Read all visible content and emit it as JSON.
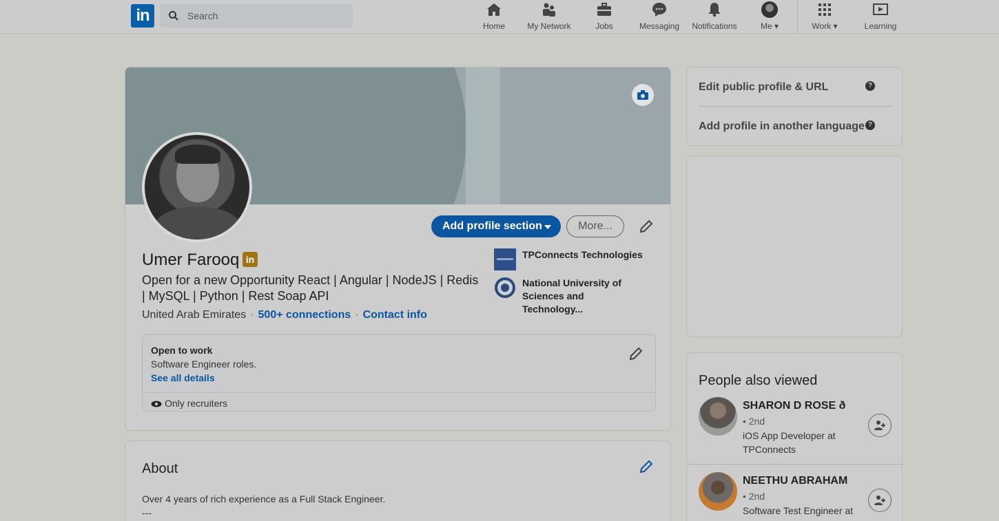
{
  "nav": {
    "logo_text": "in",
    "search_placeholder": "Search",
    "items": [
      {
        "label": "Home",
        "icon": "home-icon"
      },
      {
        "label": "My Network",
        "icon": "network-icon"
      },
      {
        "label": "Jobs",
        "icon": "briefcase-icon"
      },
      {
        "label": "Messaging",
        "icon": "messaging-icon"
      },
      {
        "label": "Notifications",
        "icon": "bell-icon"
      },
      {
        "label": "Me",
        "icon": "avatar"
      },
      {
        "label": "Work",
        "icon": "grid-icon"
      },
      {
        "label": "Learning",
        "icon": "learning-icon"
      }
    ]
  },
  "profile": {
    "name": "Umer Farooq",
    "badge": "in",
    "headline": "Open for a new Opportunity React | Angular | NodeJS | Redis | MySQL | Python | Rest Soap API",
    "location": "United Arab Emirates",
    "connections": "500+ connections",
    "contact": "Contact info",
    "add_section_label": "Add profile section",
    "more_label": "More...",
    "orgs": [
      {
        "name": "TPConnects Technologies"
      },
      {
        "name": "National University of Sciences and Technology..."
      }
    ],
    "open_to_work": {
      "title": "Open to work",
      "subtitle": "Software Engineer roles.",
      "link": "See all details",
      "visibility": "Only recruiters"
    }
  },
  "about": {
    "title": "About",
    "text": "Over 4 years of rich experience as a Full Stack Engineer.\n---"
  },
  "sidebar": {
    "links": [
      "Edit public profile & URL",
      "Add profile in another language"
    ],
    "people_title": "People also viewed",
    "people": [
      {
        "name": "SHARON D ROSE ð",
        "degree": "• 2nd",
        "role": "iOS App Developer at TPConnects"
      },
      {
        "name": "NEETHU ABRAHAM",
        "degree": "• 2nd",
        "role": "Software Test Engineer at TPConnects"
      }
    ]
  },
  "colors": {
    "brand": "#0a56a0",
    "badge": "#a07415"
  }
}
